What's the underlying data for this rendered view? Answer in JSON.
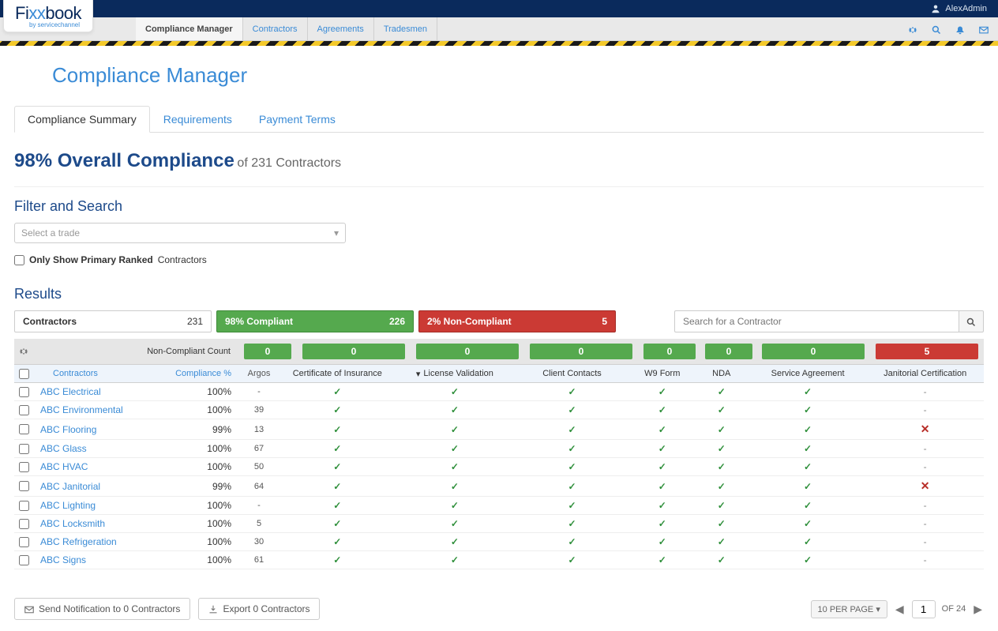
{
  "user": {
    "name": "AlexAdmin"
  },
  "logo": {
    "label_main_1": "Fi",
    "label_main_2": "xx",
    "label_main_3": "book",
    "sub": "by servicechannel"
  },
  "nav": {
    "items": [
      "Compliance Manager",
      "Contractors",
      "Agreements",
      "Tradesmen"
    ],
    "active": 0
  },
  "page_title": "Compliance Manager",
  "tabs": {
    "items": [
      "Compliance Summary",
      "Requirements",
      "Payment Terms"
    ],
    "active": 0
  },
  "overall": {
    "pct_text": "98% Overall Compliance",
    "of_text": "of 231 Contractors"
  },
  "filter": {
    "heading": "Filter and Search",
    "trade_placeholder": "Select a trade",
    "primary_label_bold": "Only Show Primary Ranked",
    "primary_label_rest": "Contractors"
  },
  "results": {
    "heading": "Results",
    "summary": {
      "contractors_label": "Contractors",
      "contractors_count": "231",
      "compliant_label": "98% Compliant",
      "compliant_count": "226",
      "noncompliant_label": "2% Non-Compliant",
      "noncompliant_count": "5"
    },
    "search_placeholder": "Search for a Contractor",
    "header1": {
      "left_label": "Non-Compliant Count",
      "counts": [
        "0",
        "0",
        "0",
        "0",
        "0",
        "0",
        "0",
        "5"
      ]
    },
    "header2": {
      "contractors_label": "Contractors",
      "compliance_label": "Compliance %",
      "argos_label": "Argos",
      "req_labels": [
        "Certificate of Insurance",
        "License Validation",
        "Client Contacts",
        "W9 Form",
        "NDA",
        "Service Agreement",
        "Janitorial Certification"
      ]
    },
    "rows": [
      {
        "name": "ABC Electrical",
        "pct": "100%",
        "argos": "-",
        "cells": [
          "check",
          "check",
          "check",
          "check",
          "check",
          "check",
          "dash"
        ]
      },
      {
        "name": "ABC Environmental",
        "pct": "100%",
        "argos": "39",
        "cells": [
          "check",
          "check",
          "check",
          "check",
          "check",
          "check",
          "dash"
        ]
      },
      {
        "name": "ABC Flooring",
        "pct": "99%",
        "argos": "13",
        "cells": [
          "check",
          "check",
          "check",
          "check",
          "check",
          "check",
          "cross"
        ]
      },
      {
        "name": "ABC Glass",
        "pct": "100%",
        "argos": "67",
        "cells": [
          "check",
          "check",
          "check",
          "check",
          "check",
          "check",
          "dash"
        ]
      },
      {
        "name": "ABC HVAC",
        "pct": "100%",
        "argos": "50",
        "cells": [
          "check",
          "check",
          "check",
          "check",
          "check",
          "check",
          "dash"
        ]
      },
      {
        "name": "ABC Janitorial",
        "pct": "99%",
        "argos": "64",
        "cells": [
          "check",
          "check",
          "check",
          "check",
          "check",
          "check",
          "cross"
        ]
      },
      {
        "name": "ABC Lighting",
        "pct": "100%",
        "argos": "-",
        "cells": [
          "check",
          "check",
          "check",
          "check",
          "check",
          "check",
          "dash"
        ]
      },
      {
        "name": "ABC Locksmith",
        "pct": "100%",
        "argos": "5",
        "cells": [
          "check",
          "check",
          "check",
          "check",
          "check",
          "check",
          "dash"
        ]
      },
      {
        "name": "ABC Refrigeration",
        "pct": "100%",
        "argos": "30",
        "cells": [
          "check",
          "check",
          "check",
          "check",
          "check",
          "check",
          "dash"
        ]
      },
      {
        "name": "ABC Signs",
        "pct": "100%",
        "argos": "61",
        "cells": [
          "check",
          "check",
          "check",
          "check",
          "check",
          "check",
          "dash"
        ]
      }
    ]
  },
  "footer": {
    "notify_label": "Send Notification to 0 Contractors",
    "export_label": "Export 0 Contractors",
    "per_page": "10  PER PAGE",
    "page_current": "1",
    "page_of": "OF 24"
  }
}
